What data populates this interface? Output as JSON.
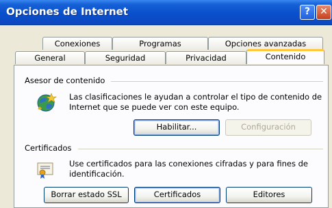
{
  "window": {
    "title": "Opciones de Internet",
    "help_glyph": "?",
    "close_glyph": "✕"
  },
  "tabs_row1": [
    {
      "label": "Conexiones"
    },
    {
      "label": "Programas"
    },
    {
      "label": "Opciones avanzadas"
    }
  ],
  "tabs_row2": [
    {
      "label": "General"
    },
    {
      "label": "Seguridad"
    },
    {
      "label": "Privacidad"
    },
    {
      "label": "Contenido",
      "active": true
    }
  ],
  "content_advisor": {
    "group_label": "Asesor de contenido",
    "description_line1": "Las clasificaciones le ayudan a controlar el tipo de contenido de",
    "description_line2": "Internet que se puede ver con este equipo.",
    "enable_button": "Habilitar...",
    "settings_button": "Configuración",
    "icon": "content-advisor-globe-icon"
  },
  "certificates": {
    "group_label": "Certificados",
    "description_line1": "Use certificados para las conexiones cifradas y para fines de",
    "description_line2": "identificación.",
    "clear_ssl_button": "Borrar estado SSL",
    "certificates_button": "Certificados",
    "publishers_button": "Editores",
    "icon": "certificate-icon"
  },
  "colors": {
    "titlebar": "#0a4fcd",
    "dialog_bg": "#ece9d8",
    "active_tab_highlight": "#ffc73c"
  }
}
